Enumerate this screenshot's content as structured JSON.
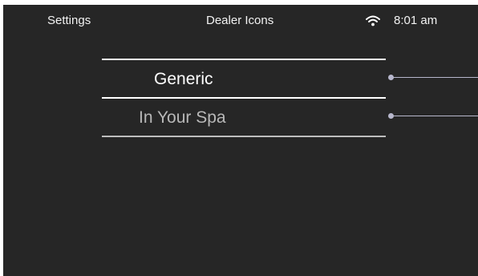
{
  "header": {
    "back_label": "Settings",
    "title": "Dealer Icons",
    "time": "8:01 am",
    "wifi_icon": "wifi-icon"
  },
  "list": {
    "items": [
      {
        "label": "Generic",
        "selected": true
      },
      {
        "label": "In Your Spa",
        "selected": false
      }
    ]
  },
  "colors": {
    "background": "#262626",
    "selected_text": "#ffffff",
    "unselected_text": "#b8b8b8",
    "selected_divider": "#ffffff",
    "unselected_divider": "#bdbdbd",
    "connector": "#b7b7cc"
  }
}
